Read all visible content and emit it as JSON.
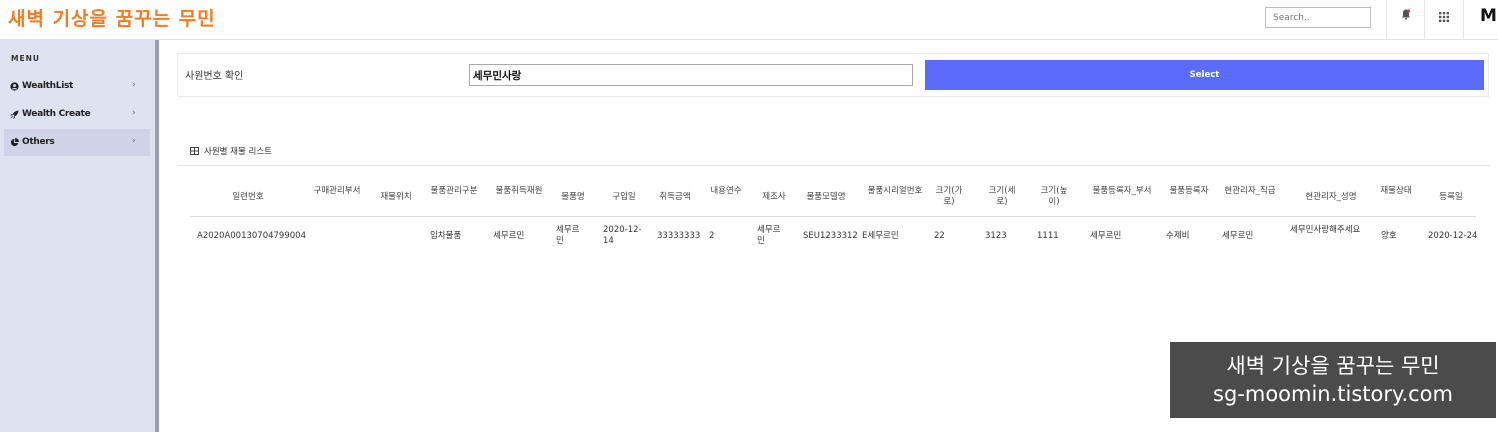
{
  "header": {
    "brand": "새벽 기상을 꿈꾸는 무민",
    "search_placeholder": "Search..",
    "avatar_initial": "M"
  },
  "sidebar": {
    "menu_heading": "MENU",
    "items": [
      {
        "label": "WealthList",
        "icon": "user-circle-icon"
      },
      {
        "label": "Wealth Create",
        "icon": "rocket-icon"
      },
      {
        "label": "Others",
        "icon": "pie-chart-icon"
      }
    ],
    "active_index": 2
  },
  "form": {
    "label": "사원번호 확인",
    "input_value": "세무민사랑",
    "button_label": "Select",
    "button_color": "#5b6bfb"
  },
  "section": {
    "title": "사원별 재물 리스트"
  },
  "table": {
    "headers": [
      "일련번호",
      "구매관리부서",
      "재물위치",
      "물품관리구분",
      "물품취득재원",
      "물품명",
      "구입일",
      "취득금액",
      "내용연수",
      "제조사",
      "물품모델명",
      "물품시리얼번호",
      "크기(가로)",
      "크기(세로)",
      "크기(높이)",
      "물품등록자_부서",
      "물품등록자",
      "현관리자_직급",
      "현관리자_성명",
      "재물상태",
      "등록일"
    ],
    "rows": [
      [
        "A2020A00130704799004",
        "",
        "",
        "임차물품",
        "세무르민",
        "세무르민",
        "2020-12-14",
        "33333333",
        "2",
        "세무르민",
        "SEU1233312",
        "E세무르민",
        "22",
        "3123",
        "1111",
        "세무르민",
        "수제비",
        "세무르민",
        "세무민사랑해주세요",
        "양호",
        "2020-12-24"
      ]
    ]
  },
  "watermark": {
    "line1": "새벽 기상을 꿈꾸는 무민",
    "line2": "sg-moomin.tistory.com"
  },
  "colors": {
    "brand": "#f47c20",
    "sidebar_bg": "#dfe3f1",
    "primary": "#5b6bfb"
  }
}
